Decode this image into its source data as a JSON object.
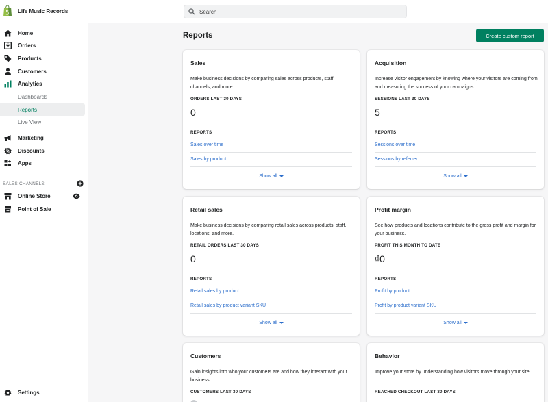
{
  "app": {
    "store_name": "Life Music Records"
  },
  "search": {
    "placeholder": "Search"
  },
  "sidebar": {
    "items": [
      {
        "label": "Home",
        "icon": "home-icon"
      },
      {
        "label": "Orders",
        "icon": "orders-icon"
      },
      {
        "label": "Products",
        "icon": "tag-icon"
      },
      {
        "label": "Customers",
        "icon": "person-icon"
      },
      {
        "label": "Analytics",
        "icon": "bar-chart-icon"
      }
    ],
    "analytics_sub": [
      {
        "label": "Dashboards"
      },
      {
        "label": "Reports",
        "active": true
      },
      {
        "label": "Live View"
      }
    ],
    "items2": [
      {
        "label": "Marketing",
        "icon": "megaphone-icon"
      },
      {
        "label": "Discounts",
        "icon": "discount-icon"
      },
      {
        "label": "Apps",
        "icon": "apps-icon"
      }
    ],
    "channels_header": "SALES CHANNELS",
    "channels": [
      {
        "label": "Online Store",
        "icon": "store-icon"
      },
      {
        "label": "Point of Sale",
        "icon": "pos-icon"
      }
    ],
    "settings": {
      "label": "Settings",
      "icon": "gear-icon"
    }
  },
  "page": {
    "title": "Reports",
    "primary_action": "Create custom report"
  },
  "cards": [
    {
      "title": "Sales",
      "description": "Make business decisions by comparing sales across products, staff, channels, and more.",
      "metric_label": "ORDERS LAST 30 DAYS",
      "metric_value": "0",
      "reports_label": "REPORTS",
      "links": [
        "Sales over time",
        "Sales by product"
      ],
      "show_all": "Show all"
    },
    {
      "title": "Acquisition",
      "description": "Increase visitor engagement by knowing where your visitors are coming from and measuring the success of your campaigns.",
      "metric_label": "SESSIONS LAST 30 DAYS",
      "metric_value": "5",
      "reports_label": "REPORTS",
      "links": [
        "Sessions over time",
        "Sessions by referrer"
      ],
      "show_all": "Show all"
    },
    {
      "title": "Retail sales",
      "description": "Make business decisions by comparing retail sales across products, staff, locations, and more.",
      "metric_label": "RETAIL ORDERS LAST 30 DAYS",
      "metric_value": "0",
      "reports_label": "REPORTS",
      "links": [
        "Retail sales by product",
        "Retail sales by product variant SKU"
      ],
      "show_all": "Show all"
    },
    {
      "title": "Profit margin",
      "description": "See how products and locations contribute to the gross profit and margin for your business.",
      "metric_label": "PROFIT THIS MONTH TO DATE",
      "metric_value": "₫0",
      "reports_label": "REPORTS",
      "links": [
        "Profit by product",
        "Profit by product variant SKU"
      ],
      "show_all": "Show all"
    },
    {
      "title": "Customers",
      "description": "Gain insights into who your customers are and how they interact with your business.",
      "metric_label": "CUSTOMERS LAST 30 DAYS"
    },
    {
      "title": "Behavior",
      "description": "Improve your store by understanding how visitors move through your site.",
      "metric_label": "REACHED CHECKOUT LAST 30 DAYS"
    }
  ],
  "colors": {
    "accent": "#008060",
    "link": "#2c6ecb",
    "active_bg": "#edeeef"
  }
}
